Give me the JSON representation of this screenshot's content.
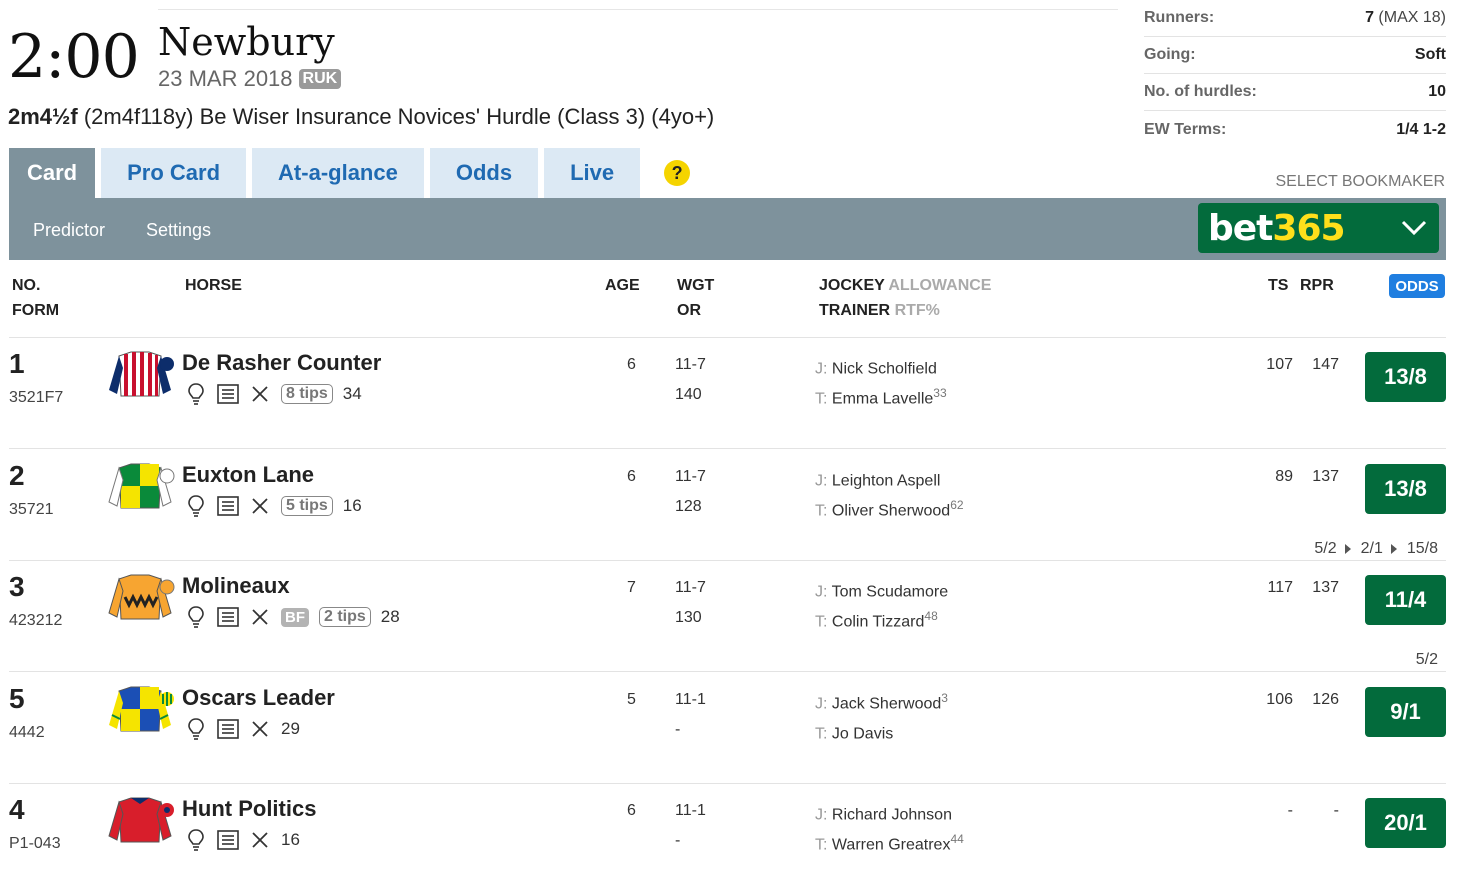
{
  "race": {
    "time": "2:00",
    "course": "Newbury",
    "date": "23 MAR 2018",
    "channel": "RUK",
    "distance": "2m4½f",
    "description": "(2m4f118y) Be Wiser Insurance Novices' Hurdle (Class 3) (4yo+)"
  },
  "info": [
    {
      "label": "Runners:",
      "value": "7",
      "extra": "(MAX 18)"
    },
    {
      "label": "Going:",
      "value": "Soft",
      "extra": ""
    },
    {
      "label": "No. of hurdles:",
      "value": "10",
      "extra": ""
    },
    {
      "label": "EW Terms:",
      "value": "1/4 1-2",
      "extra": ""
    }
  ],
  "tabs": [
    "Card",
    "Pro Card",
    "At-a-glance",
    "Odds",
    "Live"
  ],
  "help_icon": "?",
  "select_bookmaker": "SELECT BOOKMAKER",
  "subnav": [
    "Predictor",
    "Settings"
  ],
  "bookmaker": {
    "part1": "bet",
    "part2": "365",
    "color": "#036b3c"
  },
  "headers": {
    "no": "NO.",
    "form": "FORM",
    "horse": "HORSE",
    "age": "AGE",
    "wgt": "WGT",
    "or": "OR",
    "jockey": "JOCKEY",
    "allowance": "ALLOWANCE",
    "trainer": "TRAINER",
    "rtf": "RTF%",
    "ts": "TS",
    "rpr": "RPR",
    "odds": "ODDS"
  },
  "runners": [
    {
      "no": "1",
      "form": "3521F7",
      "name": "De Rasher Counter",
      "tips": "8 tips",
      "bf": "",
      "rating": "34",
      "age": "6",
      "wgt": "11-7",
      "or": "140",
      "jockey": "Nick Scholfield",
      "jockey_sup": "",
      "trainer": "Emma Lavelle",
      "trainer_sup": "33",
      "ts": "107",
      "rpr": "147",
      "odds": "13/8",
      "moves": [],
      "silk": "stripes"
    },
    {
      "no": "2",
      "form": "35721",
      "name": "Euxton Lane",
      "tips": "5 tips",
      "bf": "",
      "rating": "16",
      "age": "6",
      "wgt": "11-7",
      "or": "128",
      "jockey": "Leighton Aspell",
      "jockey_sup": "",
      "trainer": "Oliver Sherwood",
      "trainer_sup": "62",
      "ts": "89",
      "rpr": "137",
      "odds": "13/8",
      "moves": [
        "5/2",
        "2/1",
        "15/8"
      ],
      "silk": "quartered-green"
    },
    {
      "no": "3",
      "form": "423212",
      "name": "Molineaux",
      "tips": "2 tips",
      "bf": "BF",
      "rating": "28",
      "age": "7",
      "wgt": "11-7",
      "or": "130",
      "jockey": "Tom Scudamore",
      "jockey_sup": "",
      "trainer": "Colin Tizzard",
      "trainer_sup": "48",
      "ts": "117",
      "rpr": "137",
      "odds": "11/4",
      "moves": [
        "5/2"
      ],
      "silk": "orange"
    },
    {
      "no": "5",
      "form": "4442",
      "name": "Oscars Leader",
      "tips": "",
      "bf": "",
      "rating": "29",
      "age": "5",
      "wgt": "11-1",
      "or": "-",
      "jockey": "Jack Sherwood",
      "jockey_sup": "3",
      "trainer": "Jo Davis",
      "trainer_sup": "",
      "ts": "106",
      "rpr": "126",
      "odds": "9/1",
      "moves": [],
      "silk": "quartered-blue"
    },
    {
      "no": "4",
      "form": "P1-043",
      "name": "Hunt Politics",
      "tips": "",
      "bf": "",
      "rating": "16",
      "age": "6",
      "wgt": "11-1",
      "or": "-",
      "jockey": "Richard Johnson",
      "jockey_sup": "",
      "trainer": "Warren Greatrex",
      "trainer_sup": "44",
      "ts": "-",
      "rpr": "-",
      "odds": "20/1",
      "moves": [],
      "silk": "red"
    }
  ],
  "labels": {
    "jockey_prefix": "J:",
    "trainer_prefix": "T:"
  }
}
